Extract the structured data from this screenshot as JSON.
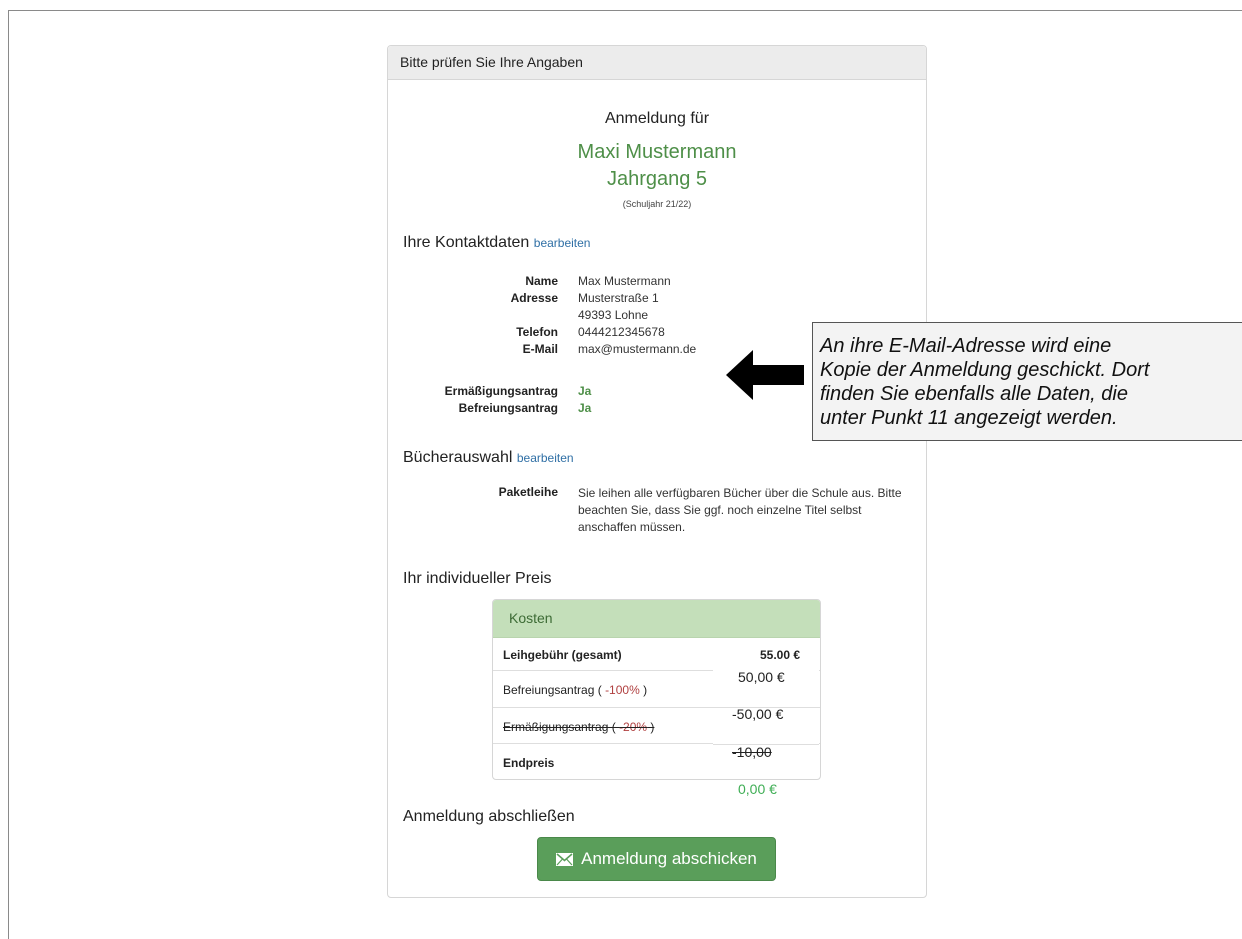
{
  "panel": {
    "heading": "Bitte prüfen Sie Ihre Angaben"
  },
  "registration": {
    "title": "Anmeldung für",
    "student_name": "Maxi Mustermann",
    "grade": "Jahrgang 5",
    "school_year": "(Schuljahr 21/22)"
  },
  "contact": {
    "title": "Ihre Kontaktdaten",
    "edit_label": "bearbeiten",
    "name_label": "Name",
    "name_value": "Max Mustermann",
    "address_label": "Adresse",
    "address_line1": "Musterstraße 1",
    "address_line2": "49393 Lohne",
    "phone_label": "Telefon",
    "phone_value": "0444212345678",
    "email_label": "E-Mail",
    "email_value": "max@mustermann.de",
    "reduction_label": "Ermäßigungsantrag",
    "reduction_value": "Ja",
    "exemption_label": "Befreiungsantrag",
    "exemption_value": "Ja"
  },
  "books": {
    "title": "Bücherauswahl",
    "edit_label": "bearbeiten",
    "package_label": "Paketleihe",
    "package_text": "Sie leihen alle verfügbaren Bücher über die Schule aus. Bitte beachten Sie, dass Sie ggf. noch einzelne Titel selbst anschaffen müssen."
  },
  "price": {
    "title": "Ihr individueller Preis",
    "costs_heading": "Kosten",
    "fee_label": "Leihgebühr (gesamt)",
    "fee_value": "55,00 €",
    "exemption_label": "Befreiungsantrag ( ",
    "exemption_pct": "-100%",
    "exemption_close": " )",
    "reduction_label": "Ermäßigungsantrag ( ",
    "reduction_pct": "-20%",
    "reduction_close": " )",
    "final_label": "Endpreis",
    "value_1": "50,00 €",
    "value_2": "-50,00 €",
    "value_3": "-10,00",
    "value_4": "0,00 €"
  },
  "finish": {
    "title": "Anmeldung abschließen",
    "submit_label": "Anmeldung abschicken"
  },
  "callout": {
    "text": "An ihre E-Mail-Adresse wird eine\nKopie der Anmeldung geschickt. Dort\nfinden Sie ebenfalls alle Daten, die\nunter Punkt 11 angezeigt werden."
  }
}
